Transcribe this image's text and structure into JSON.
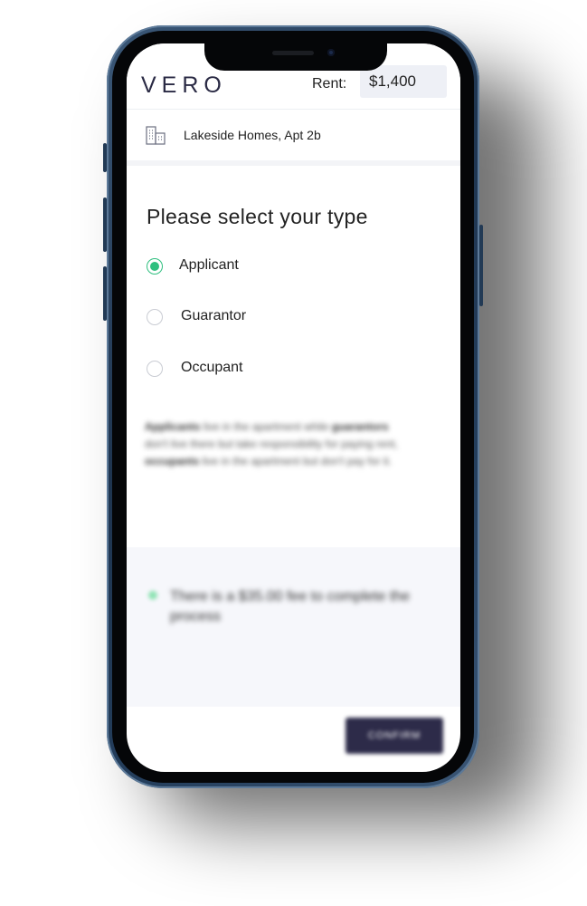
{
  "header": {
    "logo": "VERO",
    "rent_label": "Rent:",
    "rent_value": "$1,400"
  },
  "address": {
    "icon": "building-icon",
    "text": "Lakeside Homes, Apt 2b"
  },
  "form": {
    "title": "Please select your type",
    "options": [
      {
        "label": "Applicant",
        "selected": true
      },
      {
        "label": "Guarantor",
        "selected": false
      },
      {
        "label": "Occupant",
        "selected": false
      }
    ]
  },
  "help": {
    "term_applicants": "Applicants",
    "text_1": " live in the apartment while ",
    "term_guarantors": "guarantors",
    "text_2": " don't live there but take responsibility for paying rent, ",
    "term_occupants": "occupants",
    "text_3": " live in the apartment but don't pay for it."
  },
  "fee": {
    "text": "There is a $35.00 fee to complete the process"
  },
  "footer": {
    "confirm_label": "CONFIRM"
  },
  "colors": {
    "accent": "#2fbf7f",
    "brand": "#2d2b49"
  }
}
